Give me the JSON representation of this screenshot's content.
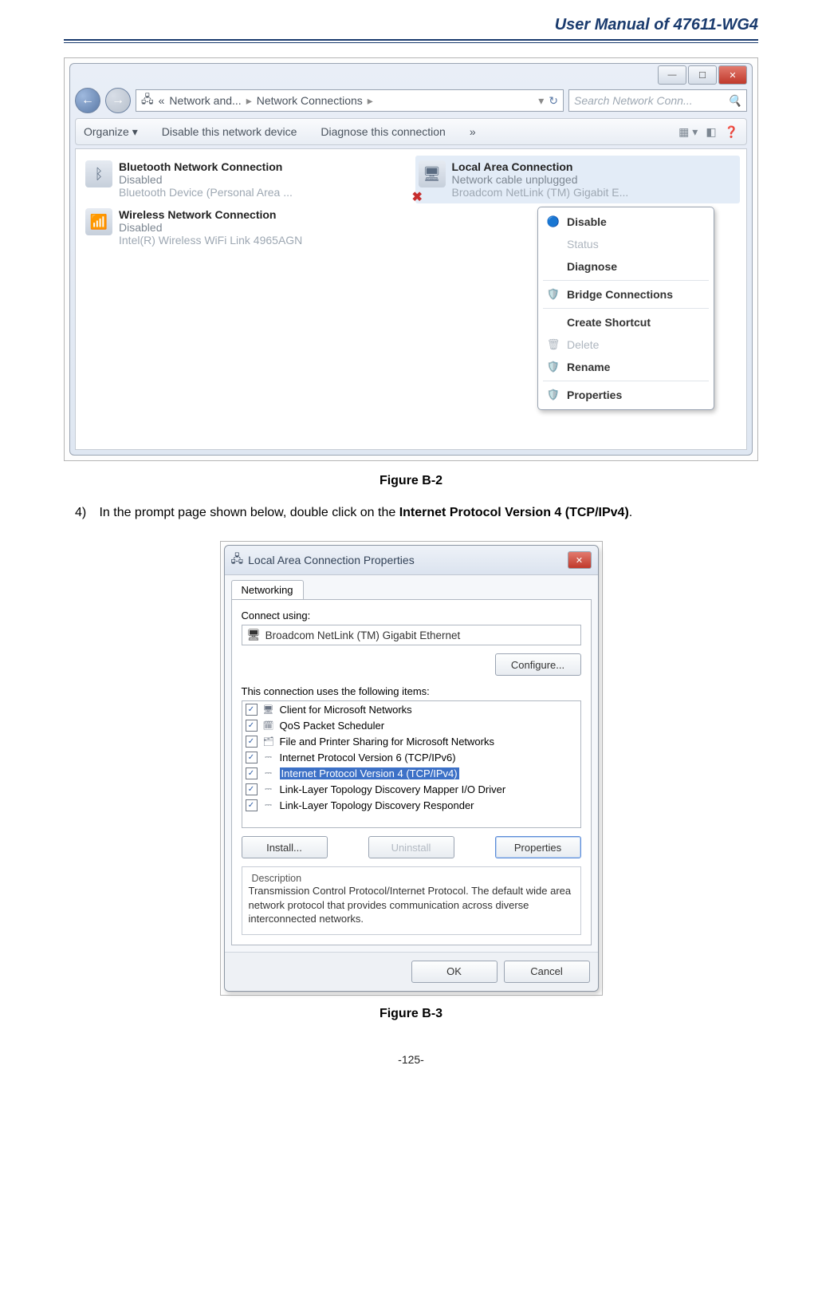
{
  "header": {
    "title": "User Manual of 47611-WG4"
  },
  "figure1": {
    "caption": "Figure B-2",
    "window_controls": {
      "min": "—",
      "max": "☐",
      "close": "✕"
    },
    "breadcrumb": {
      "chevron": "«",
      "part1": "Network and...",
      "part2": "Network Connections",
      "dropdown_glyph": "▾",
      "refresh_glyph": "↻"
    },
    "search_placeholder": "Search Network Conn...",
    "toolbar": {
      "organize": "Organize ▾",
      "disable": "Disable this network device",
      "diagnose": "Diagnose this connection",
      "overflow": "»",
      "view_glyph": "▦ ▾",
      "pane_glyph": "◧",
      "help_glyph": "❓"
    },
    "connections": [
      {
        "title": "Bluetooth Network Connection",
        "status": "Disabled",
        "device": "Bluetooth Device (Personal Area ..."
      },
      {
        "title": "Wireless Network Connection",
        "status": "Disabled",
        "device": "Intel(R) Wireless WiFi Link 4965AGN"
      },
      {
        "title": "Local Area Connection",
        "status": "Network cable unplugged",
        "device": "Broadcom NetLink (TM) Gigabit E..."
      }
    ],
    "context_menu": [
      {
        "label": "Disable",
        "enabled": true,
        "icon": "🔵"
      },
      {
        "label": "Status",
        "enabled": false,
        "icon": ""
      },
      {
        "label": "Diagnose",
        "enabled": true,
        "icon": ""
      },
      {
        "label": "Bridge Connections",
        "enabled": true,
        "icon": "🛡️"
      },
      {
        "label": "Create Shortcut",
        "enabled": true,
        "icon": ""
      },
      {
        "label": "Delete",
        "enabled": false,
        "icon": "🗑"
      },
      {
        "label": "Rename",
        "enabled": true,
        "icon": "🛡️"
      },
      {
        "label": "Properties",
        "enabled": true,
        "icon": "🛡️"
      }
    ]
  },
  "step4": {
    "number": "4)",
    "text_before": "In the prompt page shown below, double click on the ",
    "text_bold": "Internet Protocol Version 4 (TCP/IPv4)",
    "text_after": "."
  },
  "figure2": {
    "caption": "Figure B-3",
    "title": "Local Area Connection Properties",
    "close_glyph": "✕",
    "tab": "Networking",
    "connect_label": "Connect using:",
    "adapter": "Broadcom NetLink (TM) Gigabit Ethernet",
    "configure_btn": "Configure...",
    "items_label": "This connection uses the following items:",
    "items": [
      "Client for Microsoft Networks",
      "QoS Packet Scheduler",
      "File and Printer Sharing for Microsoft Networks",
      "Internet Protocol Version 6 (TCP/IPv6)",
      "Internet Protocol Version 4 (TCP/IPv4)",
      "Link-Layer Topology Discovery Mapper I/O Driver",
      "Link-Layer Topology Discovery Responder"
    ],
    "selected_index": 4,
    "install_btn": "Install...",
    "uninstall_btn": "Uninstall",
    "properties_btn": "Properties",
    "description_label": "Description",
    "description": "Transmission Control Protocol/Internet Protocol. The default wide area network protocol that provides communication across diverse interconnected networks.",
    "ok_btn": "OK",
    "cancel_btn": "Cancel"
  },
  "page_number": "-125-"
}
